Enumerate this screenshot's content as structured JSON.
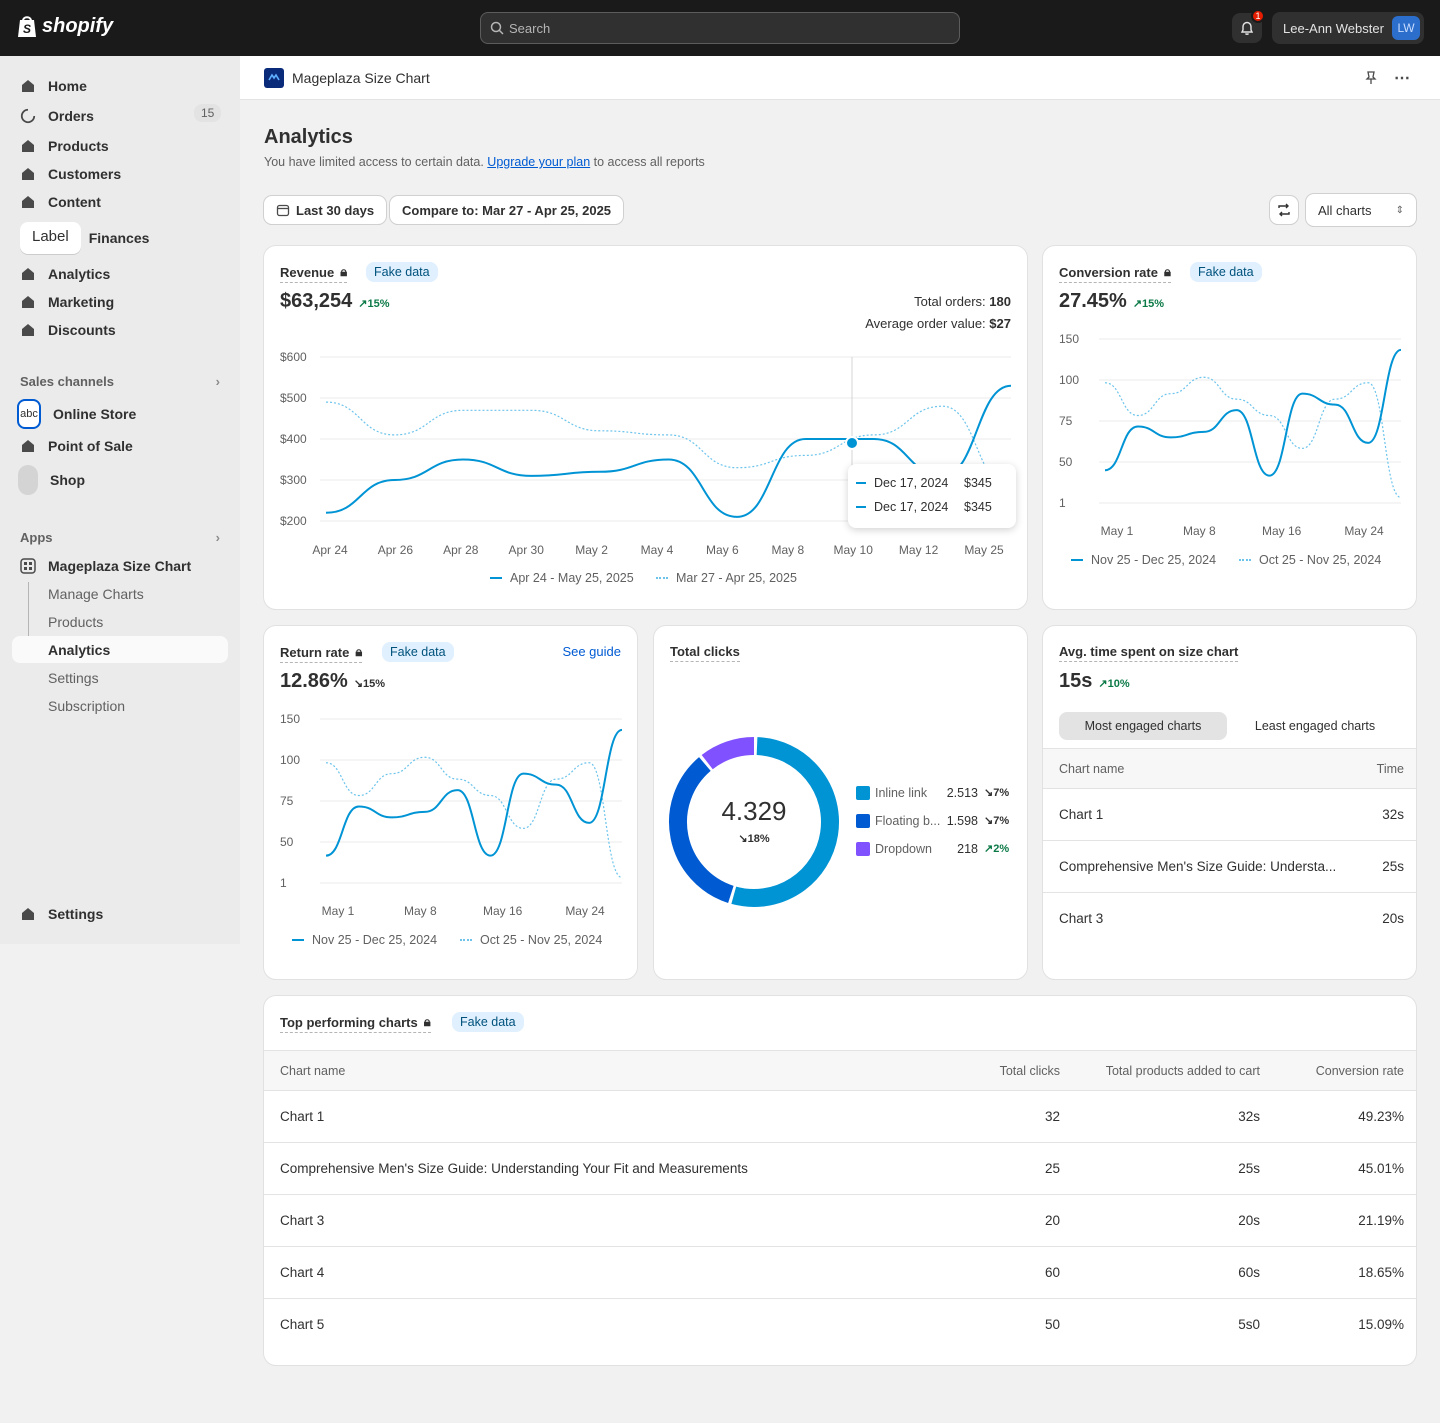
{
  "topbar": {
    "brand": "shopify",
    "search_placeholder": "Search",
    "notification_count": "1",
    "user_name": "Lee-Ann Webster",
    "user_initials": "LW"
  },
  "sidebar": {
    "items": [
      {
        "label": "Home",
        "icon": "home-icon"
      },
      {
        "label": "Orders",
        "icon": "orders-icon",
        "count": "15"
      },
      {
        "label": "Products",
        "icon": "products-icon"
      },
      {
        "label": "Customers",
        "icon": "customers-icon"
      },
      {
        "label": "Content",
        "icon": "content-icon"
      },
      {
        "label": "Analytics",
        "icon": "analytics-icon"
      },
      {
        "label": "Marketing",
        "icon": "marketing-icon"
      },
      {
        "label": "Discounts",
        "icon": "discounts-icon"
      }
    ],
    "tab_label": "Label",
    "tab_finances": "Finances",
    "sales_channels_heading": "Sales channels",
    "sales_channels": [
      {
        "label": "Online Store"
      },
      {
        "label": "Point of Sale"
      },
      {
        "label": "Shop"
      }
    ],
    "apps_heading": "Apps",
    "app_name": "Mageplaza Size Chart",
    "app_subitems": [
      {
        "label": "Manage Charts"
      },
      {
        "label": "Products"
      },
      {
        "label": "Analytics"
      },
      {
        "label": "Settings"
      },
      {
        "label": "Subscription"
      }
    ],
    "settings_label": "Settings"
  },
  "app_header": {
    "title": "Mageplaza Size Chart"
  },
  "page": {
    "title": "Analytics",
    "notice_prefix": "You have limited access to certain data.",
    "notice_link": "Upgrade your plan",
    "notice_suffix": "to access all reports",
    "date_range_button": "Last 30 days",
    "compare_button": "Compare to: Mar 27 - Apr 25, 2025",
    "charts_select": "All charts"
  },
  "revenue": {
    "title": "Revenue",
    "badge": "Fake data",
    "value": "$63,254",
    "trend": "↗15%",
    "total_orders_label": "Total orders:",
    "total_orders_value": "180",
    "aov_label": "Average order value:",
    "aov_value": "$27",
    "tooltip": [
      {
        "date": "Dec 17, 2024",
        "value": "$345"
      },
      {
        "date": "Dec 17, 2024",
        "value": "$345"
      }
    ],
    "legend_current": "Apr 24 - May 25, 2025",
    "legend_previous": "Mar 27 - Apr 25, 2025"
  },
  "conversion": {
    "title": "Conversion rate",
    "badge": "Fake data",
    "value": "27.45%",
    "trend": "↗15%",
    "legend_current": "Nov 25 - Dec 25, 2024",
    "legend_previous": "Oct 25 - Nov 25, 2024"
  },
  "return_rate": {
    "title": "Return rate",
    "badge": "Fake data",
    "value": "12.86%",
    "trend": "↘15%",
    "guide_link": "See guide",
    "legend_current": "Nov 25 - Dec 25, 2024",
    "legend_previous": "Oct 25 - Nov 25, 2024"
  },
  "total_clicks": {
    "title": "Total clicks",
    "value": "4.329",
    "trend": "↘18%"
  },
  "avg_time": {
    "title": "Avg. time spent on size chart",
    "value": "15s",
    "trend": "↗10%",
    "tab_most": "Most engaged charts",
    "tab_least": "Least engaged charts",
    "col_name": "Chart name",
    "col_time": "Time",
    "rows": [
      {
        "name": "Chart 1",
        "time": "32s"
      },
      {
        "name": "Comprehensive Men's Size Guide: Understa...",
        "time": "25s"
      },
      {
        "name": "Chart 3",
        "time": "20s"
      }
    ]
  },
  "top_charts": {
    "title": "Top performing charts",
    "badge": "Fake data",
    "columns": [
      "Chart name",
      "Total clicks",
      "Total products added to cart",
      "Conversion rate"
    ],
    "rows": [
      [
        "Chart 1",
        "32",
        "32s",
        "49.23%"
      ],
      [
        "Comprehensive Men's Size Guide: Understanding Your Fit and Measurements",
        "25",
        "25s",
        "45.01%"
      ],
      [
        "Chart 3",
        "20",
        "20s",
        "21.19%"
      ],
      [
        "Chart 4",
        "60",
        "60s",
        "18.65%"
      ],
      [
        "Chart 5",
        "50",
        "5s0",
        "15.09%"
      ]
    ]
  },
  "chart_data": [
    {
      "type": "line",
      "title": "Revenue",
      "x": [
        "Apr 24",
        "Apr 26",
        "Apr 28",
        "Apr 30",
        "May 2",
        "May 4",
        "May 6",
        "May 8",
        "May 10",
        "May 12",
        "May 25"
      ],
      "y_ticks": [
        "$600",
        "$500",
        "$400",
        "$300",
        "$200"
      ],
      "ylim": [
        200,
        600
      ],
      "series": [
        {
          "name": "Apr 24 - May 25, 2025",
          "style": "solid",
          "color": "#0094d5",
          "values": [
            220,
            300,
            350,
            310,
            320,
            350,
            210,
            400,
            400,
            310,
            530
          ]
        },
        {
          "name": "Mar 27 - Apr 25, 2025",
          "style": "dotted",
          "color": "#6cc4ec",
          "values": [
            490,
            410,
            470,
            470,
            420,
            410,
            330,
            360,
            410,
            480,
            280
          ]
        }
      ]
    },
    {
      "type": "line",
      "title": "Conversion rate",
      "x": [
        "May 1",
        "May 8",
        "May 16",
        "May 24"
      ],
      "y_ticks": [
        "150",
        "100",
        "75",
        "50",
        "1"
      ],
      "series": [
        {
          "name": "Nov 25 - Dec 25, 2024",
          "style": "solid",
          "color": "#0094d5",
          "values": [
            30,
            70,
            60,
            65,
            85,
            25,
            100,
            90,
            55,
            140
          ]
        },
        {
          "name": "Oct 25 - Nov 25, 2024",
          "style": "dotted",
          "color": "#6cc4ec",
          "values": [
            110,
            80,
            100,
            115,
            95,
            80,
            50,
            95,
            110,
            5
          ]
        }
      ]
    },
    {
      "type": "line",
      "title": "Return rate",
      "x": [
        "May 1",
        "May 8",
        "May 16",
        "May 24"
      ],
      "y_ticks": [
        "150",
        "100",
        "75",
        "50",
        "1"
      ],
      "series": [
        {
          "name": "Nov 25 - Dec 25, 2024",
          "style": "solid",
          "color": "#0094d5",
          "values": [
            25,
            70,
            60,
            65,
            85,
            25,
            100,
            90,
            55,
            140
          ]
        },
        {
          "name": "Oct 25 - Nov 25, 2024",
          "style": "dotted",
          "color": "#6cc4ec",
          "values": [
            110,
            80,
            100,
            115,
            95,
            80,
            50,
            95,
            110,
            5
          ]
        }
      ]
    },
    {
      "type": "pie",
      "title": "Total clicks",
      "total": "4.329",
      "slices": [
        {
          "name": "Inline link",
          "value": "2.513",
          "numeric": 2513,
          "trend": "↘7%",
          "color": "#0094d5"
        },
        {
          "name": "Floating b...",
          "value": "1.598",
          "numeric": 1598,
          "trend": "↘7%",
          "color": "#005bd3"
        },
        {
          "name": "Dropdown",
          "value": "218",
          "numeric": 518,
          "trend": "↗2%",
          "color": "#8051ff"
        }
      ]
    }
  ]
}
